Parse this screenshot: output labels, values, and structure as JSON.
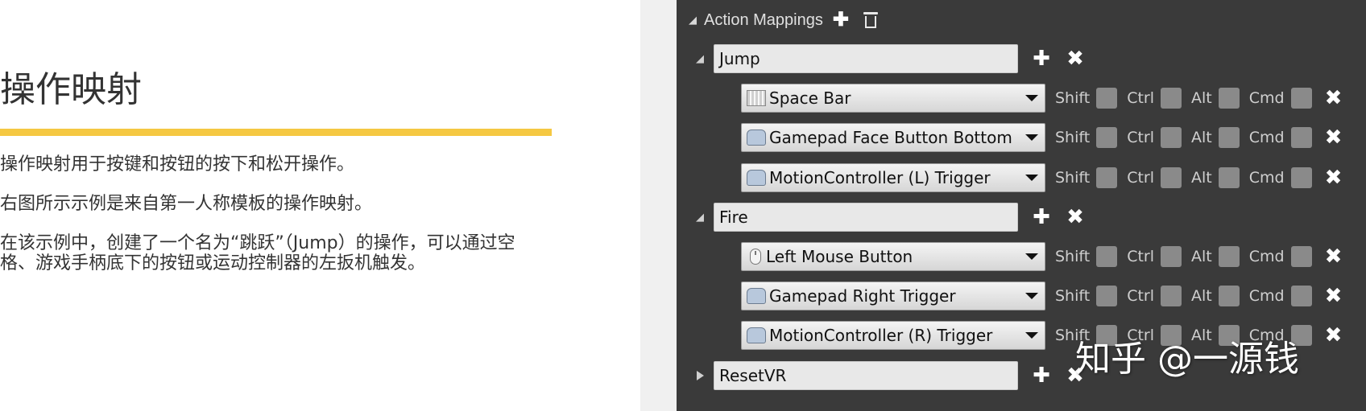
{
  "slide": {
    "title": "操作映射",
    "paragraphs": [
      "操作映射用于按键和按钮的按下和松开操作。",
      "右图所示示例是来自第一人称模板的操作映射。",
      "在该示例中，创建了一个名为“跳跃”（Jump）的操作，可以通过空格、游戏手柄底下的按钮或运动控制器的左扳机触发。"
    ]
  },
  "editor": {
    "header": {
      "label": "Action Mappings",
      "add_icon": "plus-icon",
      "delete_icon": "trash-icon"
    },
    "modifiers": {
      "shift": "Shift",
      "ctrl": "Ctrl",
      "alt": "Alt",
      "cmd": "Cmd"
    },
    "mappings": [
      {
        "name": "Jump",
        "expanded": true,
        "keys": [
          {
            "label": "Space Bar",
            "icon": "keyboard-icon"
          },
          {
            "label": "Gamepad Face Button Bottom",
            "icon": "gamepad-icon"
          },
          {
            "label": "MotionController (L) Trigger",
            "icon": "gamepad-icon"
          }
        ]
      },
      {
        "name": "Fire",
        "expanded": true,
        "keys": [
          {
            "label": "Left Mouse Button",
            "icon": "mouse-icon"
          },
          {
            "label": "Gamepad Right Trigger",
            "icon": "gamepad-icon"
          },
          {
            "label": "MotionController (R) Trigger",
            "icon": "gamepad-icon"
          }
        ]
      },
      {
        "name": "ResetVR",
        "expanded": false,
        "keys": []
      }
    ]
  },
  "watermark": "知乎 @一源钱",
  "colors": {
    "accent_bar": "#f5c842",
    "editor_bg": "#3a3a3a"
  }
}
